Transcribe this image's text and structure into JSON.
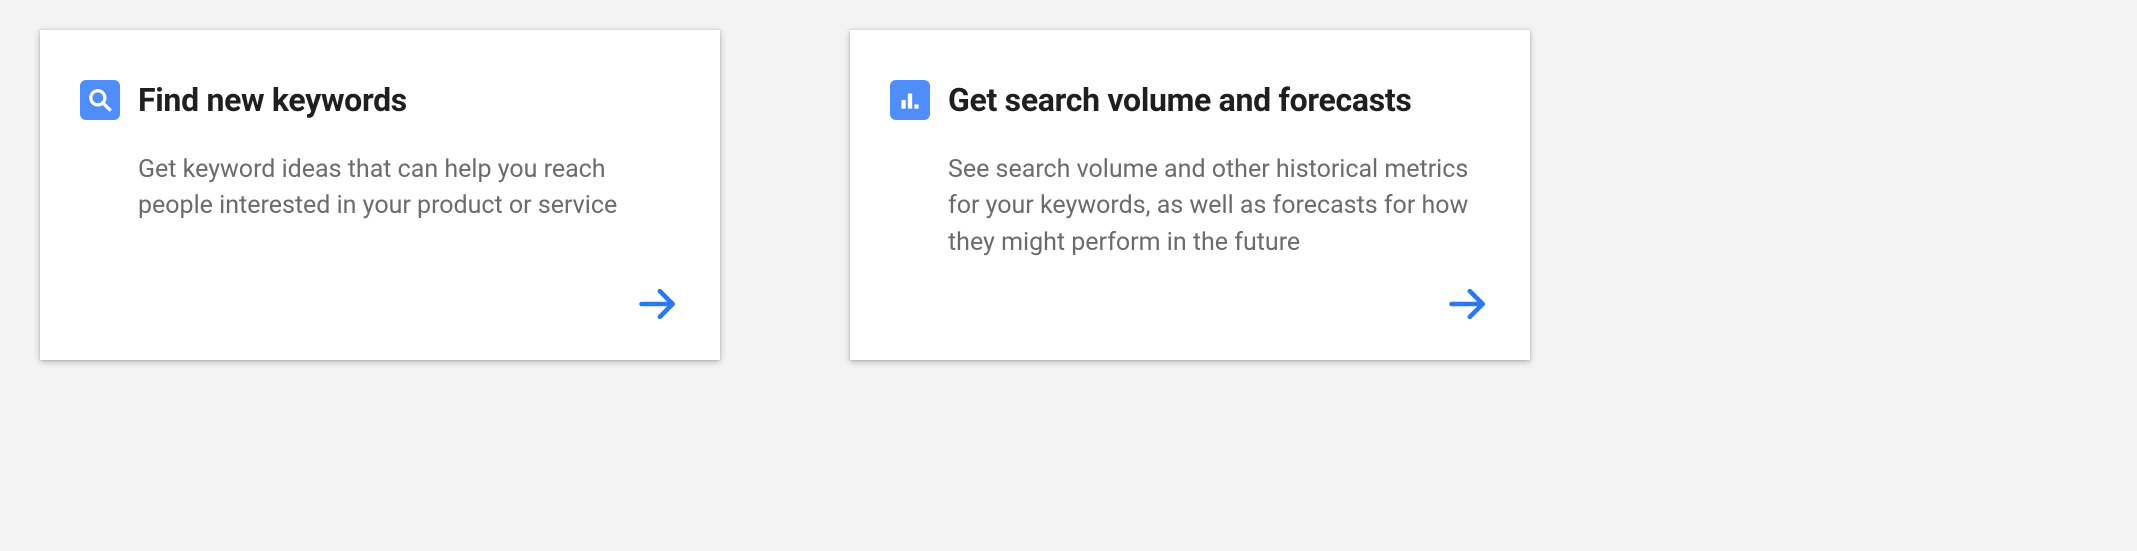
{
  "colors": {
    "accent": "#4f8df9",
    "arrow": "#2a78f4",
    "text_primary": "#1f1f1f",
    "text_secondary": "#6b6b6b",
    "background": "#f3f3f3",
    "card": "#ffffff"
  },
  "cards": [
    {
      "icon": "search-icon",
      "title": "Find new keywords",
      "description": "Get keyword ideas that can help you reach people interested in your product or service"
    },
    {
      "icon": "bar-chart-icon",
      "title": "Get search volume and forecasts",
      "description": "See search volume and other historical metrics for your keywords, as well as forecasts for how they might perform in the future"
    }
  ]
}
